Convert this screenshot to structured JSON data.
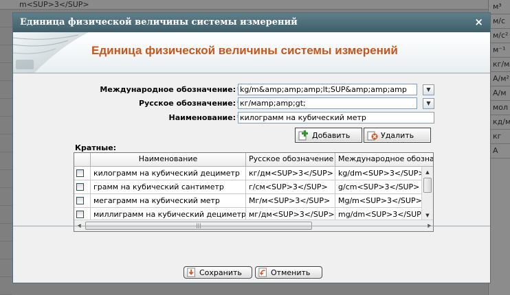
{
  "background": {
    "top_text": "m<SUP>3</SUP>",
    "right_column": [
      "м³",
      "м/с",
      "м/с²",
      "м⁻¹",
      "кг/м",
      "А/м²",
      "А/м",
      "мол",
      "кд/м",
      "кг",
      "А"
    ]
  },
  "dialog": {
    "title": "Единица физической величины системы измерений",
    "close_glyph": "×",
    "banner_title": "Единица физической величины системы измерений"
  },
  "form": {
    "intl_label": "Международное обозначение:",
    "intl_value": "kg/m&amp;amp;amp;lt;SUP&amp;amp;amp",
    "ru_label": "Русское обозначение:",
    "ru_value": "кг/мamp;amp;gt;",
    "name_label": "Наименование:",
    "name_value": "килограмм на кубический метр",
    "required_mark": "*",
    "add_button": "Добавить",
    "delete_button": "Удалить",
    "multiples_label": "Кратные:"
  },
  "grid": {
    "columns": [
      "Наименование",
      "Русское обозначение",
      "Международное обозна"
    ],
    "rows": [
      {
        "name": "килограмм на кубический дециметр",
        "ru": "кг/дм<SUP>3</SUP>",
        "intl": "kg/dm<SUP>3</SUP>"
      },
      {
        "name": "грамм на кубический сантиметр",
        "ru": "г/см<SUP>3</SUP>",
        "intl": "g/cm<SUP>3</SUP>"
      },
      {
        "name": "мегаграмм на кубический метр",
        "ru": "Мг/м<SUP>3</SUP>",
        "intl": "Mg/m<SUP>3</SUP>"
      },
      {
        "name": "миллиграмм на кубический дециметр",
        "ru": "мг/дм<SUP>3</SUP>",
        "intl": "mg/dm<SUP>3</SUP>"
      }
    ]
  },
  "footer": {
    "save_button": "Сохранить",
    "cancel_button": "Отменить"
  },
  "colors": {
    "titlebar": "#4a6a75",
    "banner_title": "#c8561a",
    "required": "#cc0000"
  }
}
